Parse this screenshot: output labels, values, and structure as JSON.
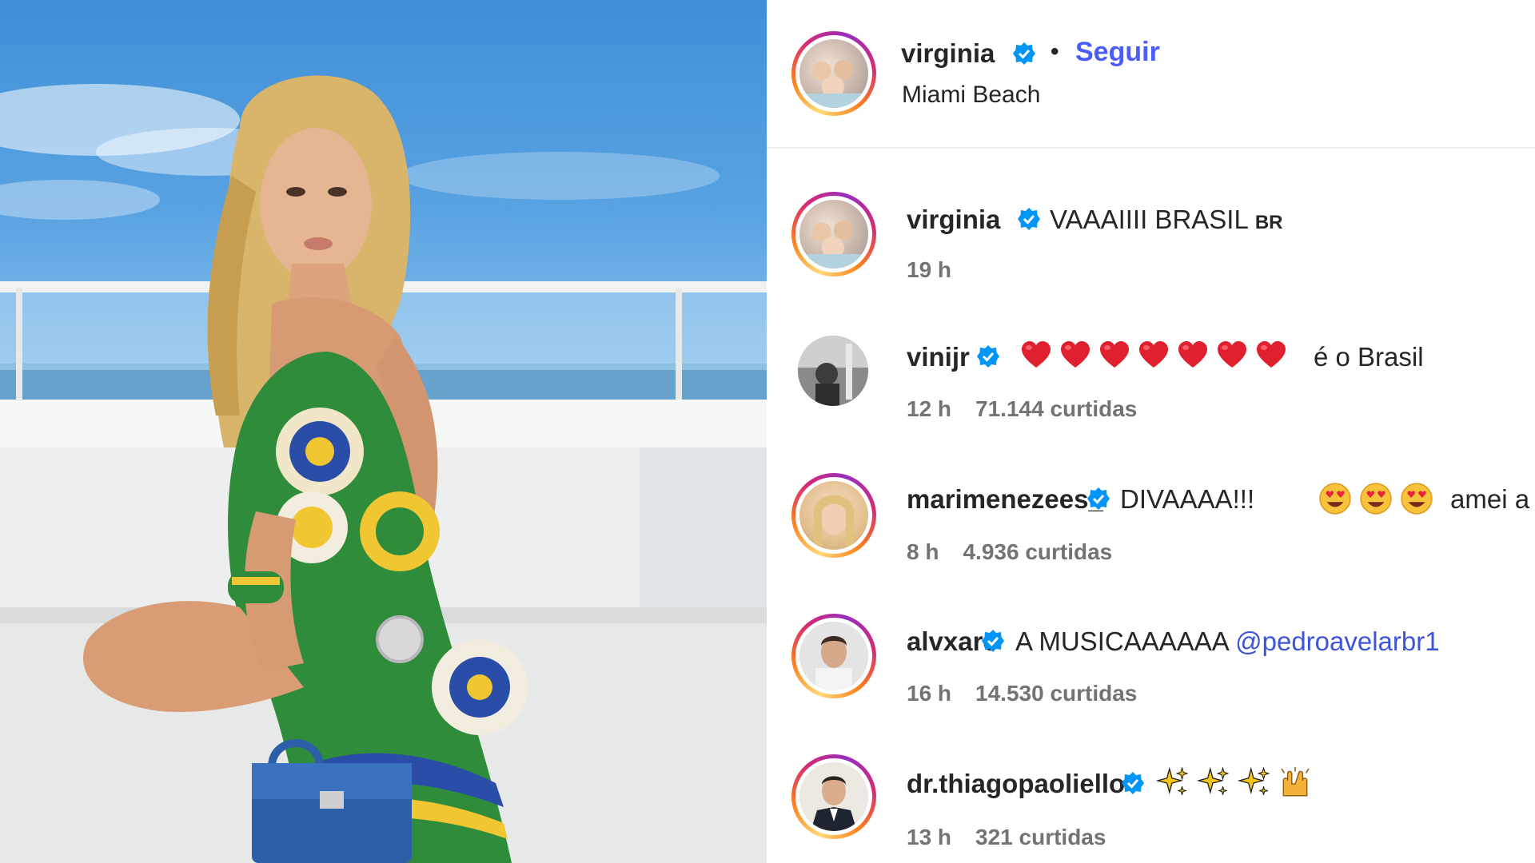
{
  "post": {
    "author": "virginia",
    "follow_label": "Seguir",
    "separator": "•",
    "location": "Miami Beach"
  },
  "comments": [
    {
      "username": "virginia",
      "text": "VAAAIIII BRASIL",
      "flag": "BR",
      "time": "19 h",
      "likes": ""
    },
    {
      "username": "vinijr",
      "text": "é o Brasil",
      "emoji": "heart",
      "emoji_count": 7,
      "time": "12 h",
      "likes": "71.144 curtidas"
    },
    {
      "username": "marimenezees_",
      "text": "DIVAAAA!!!",
      "text_after": "amei a",
      "emoji": "heart-eyes",
      "emoji_count": 3,
      "time": "8 h",
      "likes": "4.936 curtidas"
    },
    {
      "username": "alvxaro",
      "text": "A MUSICAAAAAA",
      "mention": "@pedroavelarbr1",
      "time": "16 h",
      "likes": "14.530 curtidas"
    },
    {
      "username": "dr.thiagopaoliello",
      "emoji": "sparkles",
      "emoji_count": 3,
      "emoji_extra": "raising-hands",
      "time": "13 h",
      "likes": "321 curtidas"
    }
  ],
  "colors": {
    "follow": "#4a5df9",
    "verified": "#0095f6",
    "meta": "#737373",
    "mention": "#3d55d6"
  }
}
